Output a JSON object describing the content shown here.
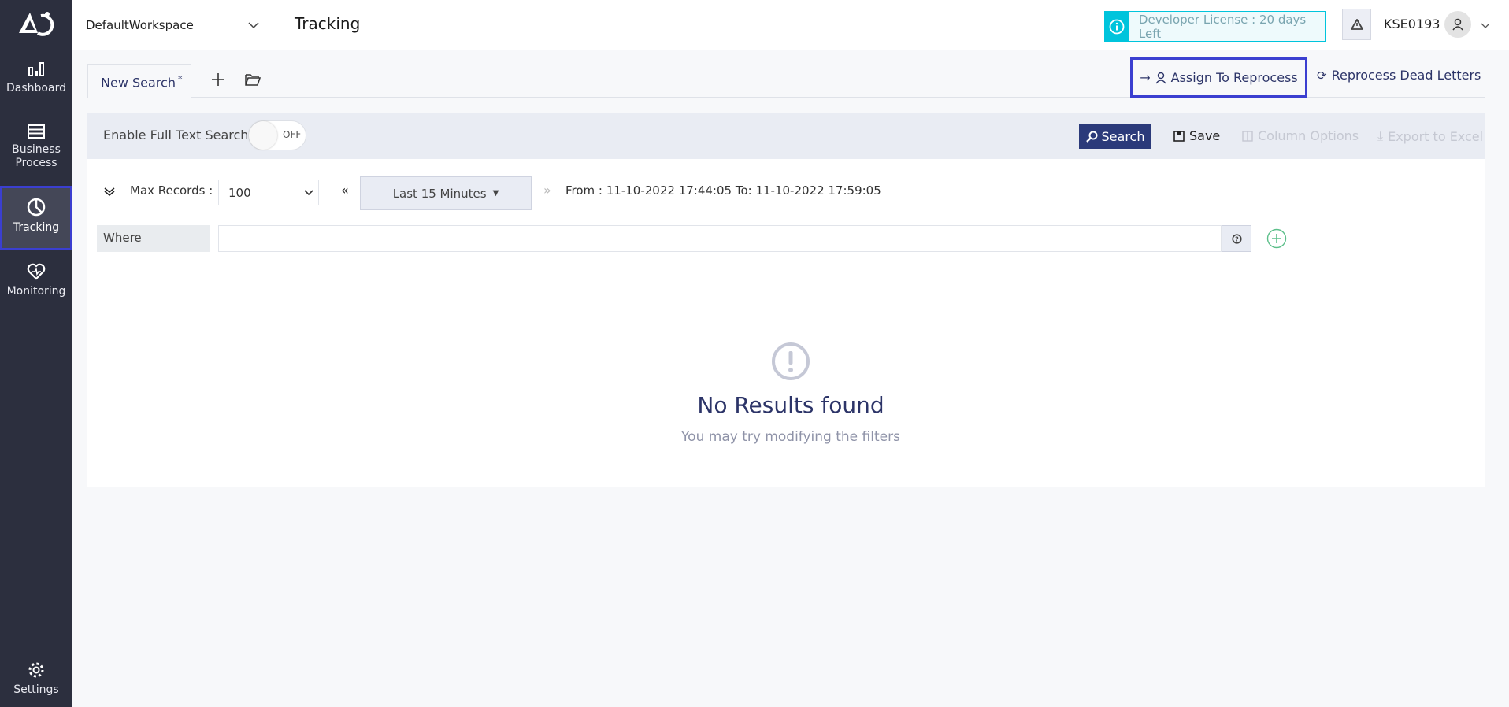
{
  "sidebar": {
    "items": [
      {
        "label": "Dashboard",
        "icon": "bar-chart-icon"
      },
      {
        "label": "Business Process",
        "icon": "server-icon"
      },
      {
        "label": "Tracking",
        "icon": "pie-chart-icon",
        "active": true
      },
      {
        "label": "Monitoring",
        "icon": "heart-pulse-icon"
      }
    ],
    "settings": "Settings"
  },
  "header": {
    "workspace": "DefaultWorkspace",
    "title": "Tracking",
    "license": "Developer License : 20 days Left",
    "user": "KSE0193"
  },
  "tabs": [
    {
      "label": "New Search",
      "modified": "*"
    }
  ],
  "actions": {
    "assign": "Assign To Reprocess",
    "reprocess": "Reprocess Dead Letters"
  },
  "toolbar": {
    "full_text_label": "Enable Full Text Search",
    "toggle": "OFF",
    "search": "Search",
    "save": "Save",
    "column_options": "Column Options",
    "export": "Export to Excel"
  },
  "filters": {
    "max_records_label": "Max Records :",
    "max_records": "100",
    "time_range": "Last 15 Minutes",
    "range_text": "From : 11-10-2022 17:44:05 To: 11-10-2022 17:59:05",
    "where_label": "Where",
    "where_value": ""
  },
  "empty": {
    "title": "No Results found",
    "subtitle": "You may try modifying the filters"
  },
  "colors": {
    "sidebar": "#2c2f3e",
    "accent": "#3b3fd0",
    "primary_button": "#2b3a7a",
    "license": "#00c4dc"
  }
}
